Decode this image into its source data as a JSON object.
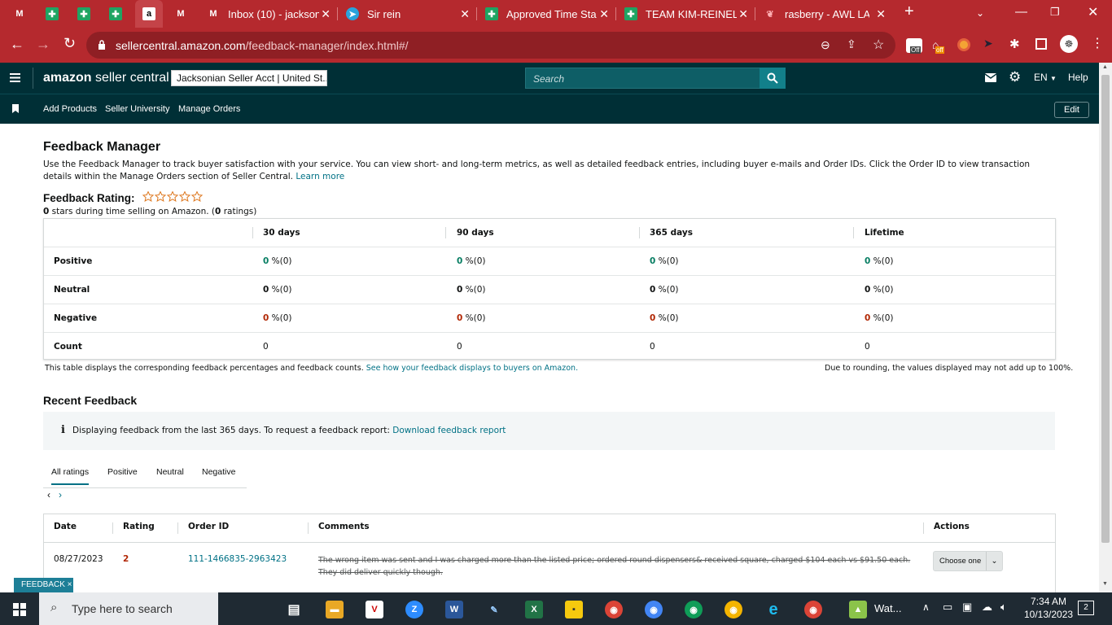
{
  "browser": {
    "tabs": [
      {
        "title": "",
        "icon": "gmail-icon"
      },
      {
        "title": "",
        "icon": "sheets-icon"
      },
      {
        "title": "",
        "icon": "sheets-icon"
      },
      {
        "title": "",
        "icon": "sheets-icon"
      },
      {
        "title": "",
        "icon": "amazon-icon"
      },
      {
        "title": "",
        "icon": "gmail-icon"
      },
      {
        "title": "Inbox (10) - jackson",
        "icon": "gmail-icon"
      },
      {
        "title": "Sir rein",
        "icon": "telegram-icon"
      },
      {
        "title": "Approved Time Sta",
        "icon": "sheets-icon"
      },
      {
        "title": "TEAM KIM-REINEL",
        "icon": "sheets-icon"
      },
      {
        "title": "rasberry - AWL LAB",
        "icon": "raspberry-icon"
      }
    ],
    "new_tab": "+",
    "url_host": "sellercentral.amazon.com",
    "url_path": "/feedback-manager/index.html#/",
    "ext_off_1": "Off",
    "ext_off_2": "off"
  },
  "header": {
    "logo_bold": "amazon",
    "logo_rest": " seller central",
    "account": "Jacksonian Seller Acct | United St...",
    "search_placeholder": "Search",
    "lang": "EN",
    "help": "Help"
  },
  "nav": {
    "items": [
      "Add Products",
      "Seller University",
      "Manage Orders"
    ],
    "edit": "Edit"
  },
  "page": {
    "title": "Feedback Manager",
    "description": "Use the Feedback Manager to track buyer satisfaction with your service. You can view short- and long-term metrics, as well as detailed feedback entries, including buyer e-mails and Order IDs. Click the Order ID to view transaction details within the Manage Orders section of Seller Central.",
    "learn_more": "Learn more",
    "rating_label": "Feedback Rating:",
    "rating_stars": 0,
    "rating_summary_num": "0",
    "rating_summary_mid": " stars during time selling on Amazon. (",
    "rating_summary_count": "0",
    "rating_summary_end": " ratings)"
  },
  "metrics": {
    "columns": [
      "30 days",
      "90 days",
      "365 days",
      "Lifetime"
    ],
    "rows": [
      {
        "label": "Positive",
        "values": [
          "0",
          "0",
          "0",
          "0"
        ],
        "suffix": " %(0)"
      },
      {
        "label": "Neutral",
        "values": [
          "0",
          "0",
          "0",
          "0"
        ],
        "suffix": " %(0)"
      },
      {
        "label": "Negative",
        "values": [
          "0",
          "0",
          "0",
          "0"
        ],
        "suffix": " %(0)"
      },
      {
        "label": "Count",
        "values": [
          "0",
          "0",
          "0",
          "0"
        ],
        "suffix": ""
      }
    ],
    "footnote": "This table displays the corresponding feedback percentages and feedback counts.",
    "footnote_link": "See how your feedback displays to buyers on Amazon.",
    "rounding_note": "Due to rounding, the values displayed may not add up to 100%."
  },
  "recent": {
    "title": "Recent Feedback",
    "info": "Displaying feedback from the last 365 days. To request a feedback report:",
    "info_link": "Download feedback report",
    "tabs": [
      "All ratings",
      "Positive",
      "Neutral",
      "Negative"
    ],
    "columns": [
      "Date",
      "Rating",
      "Order ID",
      "Comments",
      "Actions"
    ],
    "rows": [
      {
        "date": "08/27/2023",
        "rating": "2",
        "order_id": "111-1466835-2963423",
        "comment": "The wrong item was sent and I was charged more than the listed price; ordered round dispensers& received square, charged $104 each vs $91.50 each. They did deliver quickly though.",
        "action": "Choose one"
      }
    ],
    "feedback_badge": "FEEDBACK ×"
  },
  "taskbar": {
    "search_placeholder": "Type here to search",
    "app_label": "Wat...",
    "time": "7:34 AM",
    "date": "10/13/2023",
    "notifications": "2"
  },
  "colors": {
    "tabbar": "#b5292e",
    "amazon_header": "#002f36",
    "link": "#007185",
    "positive": "#067d62",
    "negative": "#b12704"
  }
}
